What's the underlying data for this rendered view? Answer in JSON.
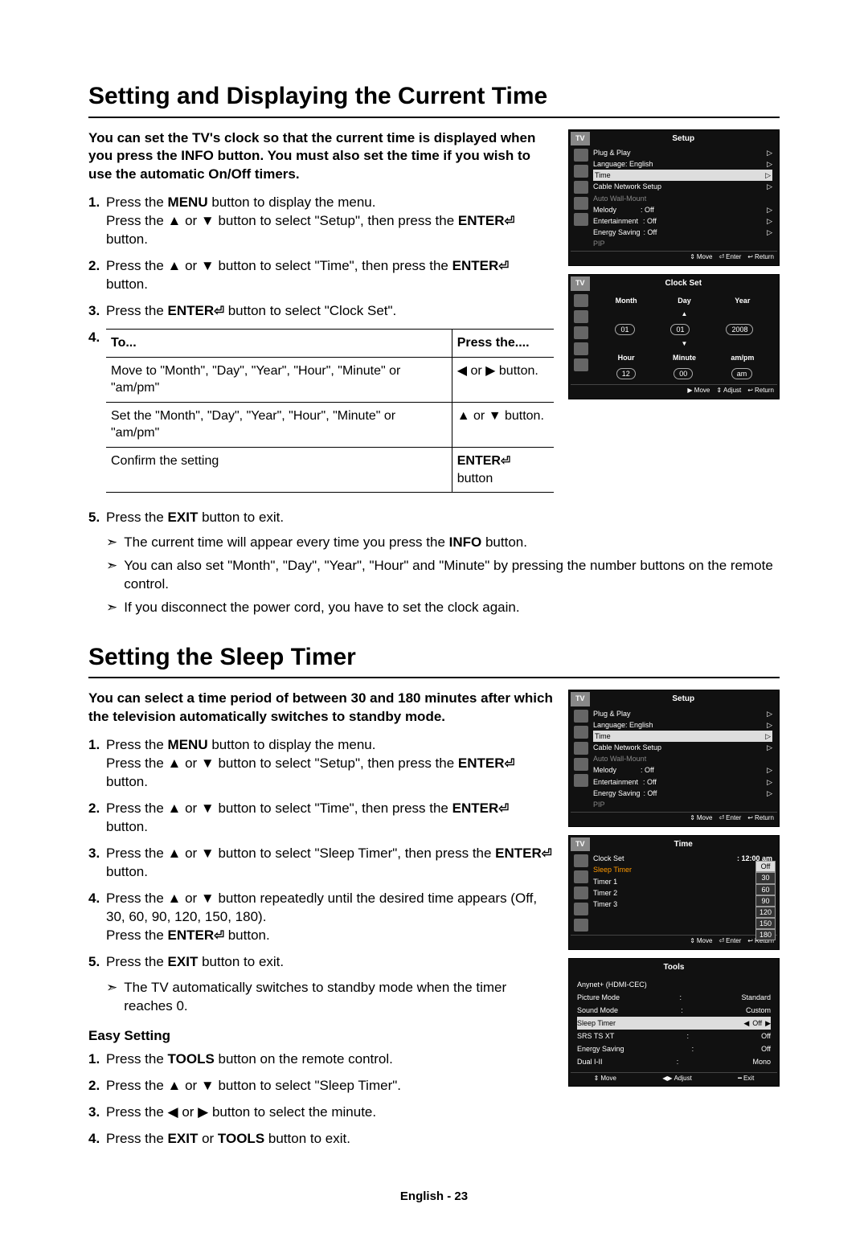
{
  "section1": {
    "title": "Setting and Displaying the Current Time",
    "intro": "You can set the TV's clock so that the current time is displayed when you press the INFO button. You must also set the time if you wish to use the automatic On/Off timers.",
    "steps": {
      "s1a": "Press the ",
      "s1b": "MENU",
      "s1c": " button to display the menu.",
      "s1d": "Press the ▲ or ▼ button to select \"Setup\", then press the ",
      "s1e": "ENTER",
      "s1f": " button.",
      "s2a": "Press the ▲ or ▼ button to select \"Time\", then press the ",
      "s2b": "ENTER",
      "s2c": " button.",
      "s3a": "Press the ",
      "s3b": "ENTER",
      "s3c": " button to select \"Clock Set\".",
      "s4": "4."
    },
    "table": {
      "h1": "To...",
      "h2": "Press the....",
      "r1c1": "Move to \"Month\", \"Day\", \"Year\", \"Hour\", \"Minute\" or \"am/pm\"",
      "r1c2": "◀ or ▶ button.",
      "r2c1": "Set the \"Month\", \"Day\", \"Year\", \"Hour\", \"Minute\" or \"am/pm\"",
      "r2c2": "▲ or ▼ button.",
      "r3c1": "Confirm the setting",
      "r3c2a": "ENTER",
      "r3c2b": " button"
    },
    "after": {
      "s5a": "Press the ",
      "s5b": "EXIT",
      "s5c": " button to exit.",
      "n1a": "The current time will appear every time you press the ",
      "n1b": "INFO",
      "n1c": " button.",
      "n2": "You can also set \"Month\", \"Day\", \"Year\", \"Hour\" and \"Minute\" by pressing the number buttons on the remote control.",
      "n3": "If you disconnect the power cord, you have to set the clock again."
    }
  },
  "osd1": {
    "tv": "TV",
    "title": "Setup",
    "rows": [
      {
        "l": "Plug & Play",
        "r": "▷"
      },
      {
        "l": "Language",
        "m": ": English",
        "r": "▷"
      },
      {
        "l": "Time",
        "r": "▷",
        "hl": true
      },
      {
        "l": "Cable Network Setup",
        "r": "▷"
      },
      {
        "l": "Auto Wall-Mount",
        "dim": true
      },
      {
        "l": "Melody",
        "m": ": Off",
        "r": "▷"
      },
      {
        "l": "Entertainment",
        "m": ": Off",
        "r": "▷"
      },
      {
        "l": "Energy Saving",
        "m": ": Off",
        "r": "▷"
      },
      {
        "l": "PIP",
        "dim": true
      }
    ],
    "footer": {
      "move": "Move",
      "enter": "Enter",
      "return": "Return"
    }
  },
  "osd2": {
    "tv": "TV",
    "title": "Clock Set",
    "labels": {
      "month": "Month",
      "day": "Day",
      "year": "Year",
      "hour": "Hour",
      "minute": "Minute",
      "ampm": "am/pm"
    },
    "vals": {
      "month": "01",
      "day": "01",
      "year": "2008",
      "hour": "12",
      "minute": "00",
      "ampm": "am"
    },
    "footer": {
      "move": "Move",
      "adjust": "Adjust",
      "return": "Return"
    }
  },
  "section2": {
    "title": "Setting the Sleep Timer",
    "intro": "You can select a time period of between 30 and 180 minutes after which the television automatically switches to standby mode.",
    "steps": {
      "s1a": "Press the ",
      "s1b": "MENU",
      "s1c": " button to display the menu.",
      "s1d": "Press the ▲ or ▼ button to select \"Setup\", then press the ",
      "s1e": "ENTER",
      "s1f": " button.",
      "s2a": "Press the ▲ or ▼ button to select \"Time\", then press the ",
      "s2b": "ENTER",
      "s2c": " button.",
      "s3a": "Press the ▲ or ▼ button to select \"Sleep Timer\", then press the ",
      "s3b": "ENTER",
      "s3c": " button.",
      "s4a": "Press the ▲ or ▼ button repeatedly until the desired time appears (Off, 30, 60, 90, 120, 150, 180).",
      "s4b": "Press the ",
      "s4c": "ENTER",
      "s4d": " button.",
      "s5a": "Press the ",
      "s5b": "EXIT",
      "s5c": " button to exit.",
      "n1": "The TV automatically switches to standby mode when the timer reaches 0."
    },
    "easy_title": "Easy Setting",
    "easy": {
      "e1a": "Press the ",
      "e1b": "TOOLS",
      "e1c": " button on the remote control.",
      "e2": "Press the ▲ or ▼ button to select \"Sleep Timer\".",
      "e3": "Press the ◀ or ▶ button to select the minute.",
      "e4a": "Press the ",
      "e4b": "EXIT",
      "e4c": " or ",
      "e4d": "TOOLS",
      "e4e": " button to exit."
    }
  },
  "osd3": {
    "tv": "TV",
    "title": "Time",
    "rows": [
      {
        "l": "Clock Set",
        "m": ": 12:00 am"
      },
      {
        "l": "Sleep Timer",
        "hl": true,
        "orange": true
      },
      {
        "l": "Timer 1",
        "m": ":",
        "dimv": true
      },
      {
        "l": "Timer 2",
        "m": ":",
        "dimv": true
      },
      {
        "l": "Timer 3",
        "m": ":",
        "dimv": true
      }
    ],
    "options": [
      "Off",
      "30",
      "60",
      "90",
      "120",
      "150",
      "180"
    ],
    "footer": {
      "move": "Move",
      "enter": "Enter",
      "return": "Return"
    }
  },
  "osd4": {
    "title": "Tools",
    "rows": [
      {
        "l": "Anynet+ (HDMI-CEC)"
      },
      {
        "l": "Picture Mode",
        "m": ":",
        "r": "Standard"
      },
      {
        "l": "Sound Mode",
        "m": ":",
        "r": "Custom"
      },
      {
        "l": "Sleep Timer",
        "r": "Off",
        "hl": true
      },
      {
        "l": "SRS TS XT",
        "m": ":",
        "r": "Off"
      },
      {
        "l": "Energy Saving",
        "m": ":",
        "r": "Off"
      },
      {
        "l": "Dual I-II",
        "m": ":",
        "r": "Mono"
      }
    ],
    "footer": {
      "move": "Move",
      "adjust": "Adjust",
      "exit": "Exit"
    }
  },
  "footer_page": "English - 23"
}
